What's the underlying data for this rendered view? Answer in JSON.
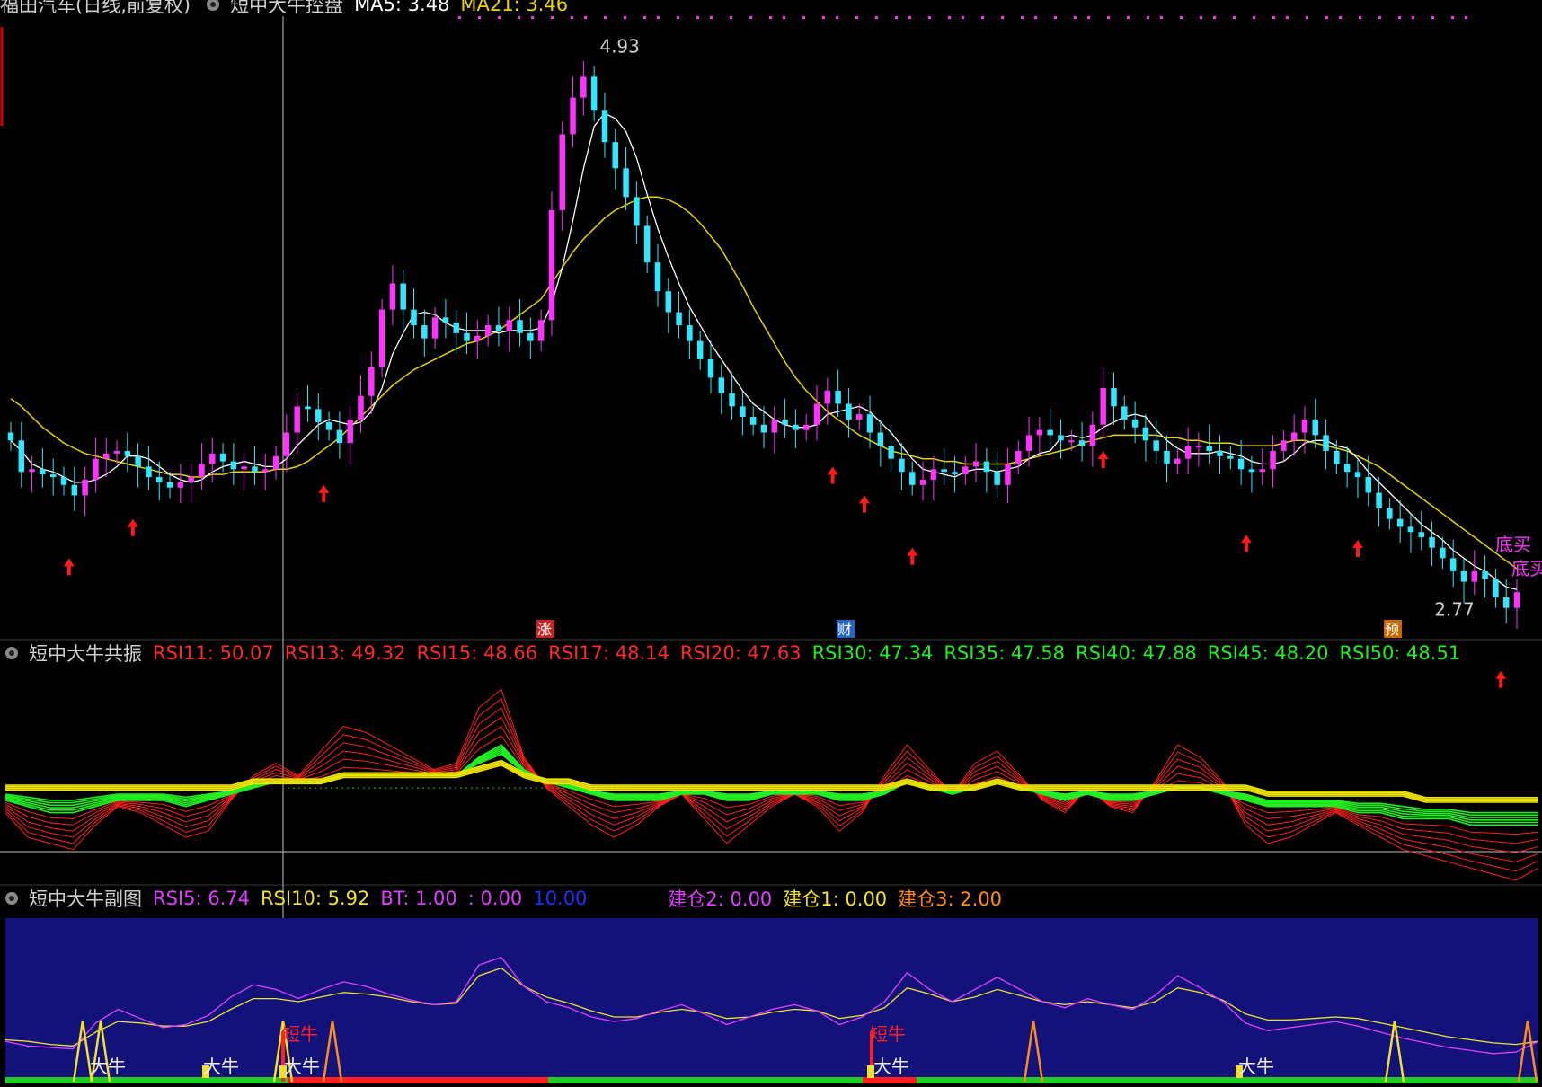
{
  "header_main": {
    "stock": "福田汽车(日线,前复权)",
    "indicator": "短中大牛控盘",
    "ma5": "MA5: 3.48",
    "ma21": "MA21: 3.46"
  },
  "colors": {
    "up": "#ff33ff",
    "down": "#33e6ff",
    "ma5": "#ffffff",
    "ma21": "#e5d400",
    "arrow": "#ff1a1a",
    "rsi_short": "#ff2020",
    "rsi_long": "#22ee22",
    "rsi_slow": "#f2e600",
    "sub_bg": "#12127a",
    "rsi5": "#e040ff",
    "rsi10": "#f0e030"
  },
  "chart_data": [
    {
      "type": "candlestick",
      "title": "福田汽车(日线,前复权)",
      "ylim": [
        2.7,
        5.0
      ],
      "high_label": "4.93",
      "low_label": "2.77",
      "close": [
        3.42,
        3.3,
        3.31,
        3.29,
        3.28,
        3.25,
        3.21,
        3.27,
        3.35,
        3.37,
        3.38,
        3.36,
        3.32,
        3.28,
        3.26,
        3.24,
        3.26,
        3.28,
        3.33,
        3.37,
        3.34,
        3.31,
        3.32,
        3.3,
        3.31,
        3.36,
        3.45,
        3.55,
        3.54,
        3.49,
        3.46,
        3.41,
        3.5,
        3.59,
        3.7,
        3.92,
        4.02,
        3.92,
        3.86,
        3.81,
        3.89,
        3.87,
        3.83,
        3.8,
        3.82,
        3.86,
        3.84,
        3.88,
        3.83,
        3.8,
        3.88,
        4.3,
        4.59,
        4.73,
        4.81,
        4.68,
        4.56,
        4.46,
        4.35,
        4.24,
        4.1,
        3.99,
        3.91,
        3.86,
        3.8,
        3.73,
        3.66,
        3.6,
        3.55,
        3.51,
        3.48,
        3.45,
        3.5,
        3.48,
        3.46,
        3.48,
        3.56,
        3.61,
        3.56,
        3.5,
        3.52,
        3.45,
        3.4,
        3.35,
        3.3,
        3.25,
        3.27,
        3.31,
        3.3,
        3.29,
        3.32,
        3.34,
        3.3,
        3.25,
        3.33,
        3.38,
        3.44,
        3.46,
        3.44,
        3.42,
        3.42,
        3.4,
        3.48,
        3.62,
        3.55,
        3.5,
        3.47,
        3.42,
        3.38,
        3.33,
        3.35,
        3.4,
        3.4,
        3.38,
        3.36,
        3.35,
        3.31,
        3.3,
        3.31,
        3.38,
        3.42,
        3.45,
        3.5,
        3.44,
        3.38,
        3.33,
        3.3,
        3.28,
        3.22,
        3.16,
        3.12,
        3.09,
        3.07,
        3.05,
        3.01,
        2.97,
        2.92,
        2.88,
        2.92,
        2.89,
        2.82,
        2.78,
        2.84
      ],
      "ma5": [
        3.42,
        3.38,
        3.33,
        3.31,
        3.3,
        3.28,
        3.26,
        3.26,
        3.27,
        3.29,
        3.32,
        3.36,
        3.36,
        3.35,
        3.32,
        3.29,
        3.27,
        3.26,
        3.27,
        3.3,
        3.32,
        3.33,
        3.34,
        3.33,
        3.32,
        3.32,
        3.35,
        3.4,
        3.44,
        3.48,
        3.5,
        3.49,
        3.48,
        3.49,
        3.53,
        3.62,
        3.75,
        3.83,
        3.9,
        3.91,
        3.9,
        3.87,
        3.85,
        3.84,
        3.84,
        3.84,
        3.83,
        3.84,
        3.84,
        3.84,
        3.85,
        3.94,
        4.08,
        4.26,
        4.46,
        4.62,
        4.67,
        4.65,
        4.6,
        4.5,
        4.36,
        4.23,
        4.12,
        4.02,
        3.93,
        3.86,
        3.79,
        3.73,
        3.67,
        3.61,
        3.56,
        3.53,
        3.5,
        3.48,
        3.47,
        3.47,
        3.48,
        3.52,
        3.53,
        3.54,
        3.55,
        3.53,
        3.49,
        3.45,
        3.4,
        3.35,
        3.31,
        3.3,
        3.29,
        3.28,
        3.3,
        3.31,
        3.31,
        3.3,
        3.31,
        3.32,
        3.35,
        3.37,
        3.38,
        3.43,
        3.44,
        3.43,
        3.44,
        3.47,
        3.49,
        3.51,
        3.52,
        3.51,
        3.46,
        3.42,
        3.39,
        3.37,
        3.37,
        3.37,
        3.38,
        3.37,
        3.36,
        3.34,
        3.33,
        3.33,
        3.34,
        3.37,
        3.41,
        3.42,
        3.42,
        3.4,
        3.39,
        3.35,
        3.3,
        3.26,
        3.22,
        3.18,
        3.14,
        3.1,
        3.07,
        3.04,
        3.0,
        2.97,
        2.94,
        2.92,
        2.89,
        2.86,
        2.85
      ],
      "ma21": [
        3.58,
        3.55,
        3.51,
        3.47,
        3.44,
        3.41,
        3.39,
        3.37,
        3.36,
        3.35,
        3.34,
        3.33,
        3.32,
        3.31,
        3.3,
        3.29,
        3.29,
        3.28,
        3.28,
        3.29,
        3.29,
        3.3,
        3.3,
        3.3,
        3.3,
        3.31,
        3.31,
        3.32,
        3.34,
        3.37,
        3.4,
        3.43,
        3.47,
        3.51,
        3.55,
        3.59,
        3.63,
        3.66,
        3.69,
        3.71,
        3.73,
        3.75,
        3.77,
        3.79,
        3.8,
        3.82,
        3.84,
        3.87,
        3.9,
        3.93,
        3.96,
        4.02,
        4.08,
        4.14,
        4.19,
        4.23,
        4.27,
        4.3,
        4.32,
        4.34,
        4.35,
        4.35,
        4.34,
        4.32,
        4.29,
        4.25,
        4.2,
        4.15,
        4.08,
        4.01,
        3.93,
        3.86,
        3.79,
        3.72,
        3.66,
        3.61,
        3.57,
        3.53,
        3.5,
        3.47,
        3.44,
        3.42,
        3.4,
        3.38,
        3.37,
        3.36,
        3.35,
        3.35,
        3.34,
        3.34,
        3.33,
        3.33,
        3.33,
        3.33,
        3.33,
        3.34,
        3.35,
        3.36,
        3.37,
        3.38,
        3.39,
        3.41,
        3.42,
        3.43,
        3.44,
        3.44,
        3.44,
        3.44,
        3.44,
        3.43,
        3.43,
        3.42,
        3.42,
        3.41,
        3.41,
        3.41,
        3.4,
        3.4,
        3.4,
        3.4,
        3.41,
        3.42,
        3.42,
        3.41,
        3.4,
        3.39,
        3.38,
        3.36,
        3.34,
        3.32,
        3.29,
        3.26,
        3.23,
        3.2,
        3.17,
        3.14,
        3.11,
        3.08,
        3.05,
        3.02,
        2.99,
        2.96,
        2.93
      ],
      "annotations": {
        "buy_text": [
          "底买",
          "底买"
        ],
        "markers": [
          "涨",
          "财",
          "预"
        ]
      }
    },
    {
      "type": "line",
      "title": "短中大牛共振",
      "legend": [
        "RSI11: 50.07",
        "RSI13: 49.32",
        "RSI15: 48.66",
        "RSI17: 48.14",
        "RSI20: 47.63",
        "RSI30: 47.34",
        "RSI35: 47.58",
        "RSI40: 47.88",
        "RSI45: 48.20",
        "RSI50: 48.51"
      ],
      "ylim": [
        35,
        70
      ],
      "series": [
        {
          "name": "RSI11",
          "values": [
            46,
            42,
            41,
            40,
            44,
            47,
            46,
            44,
            42,
            43,
            48,
            52,
            54,
            52,
            56,
            60,
            59,
            57,
            55,
            53,
            54,
            63,
            66,
            55,
            50,
            47,
            44,
            42,
            44,
            47,
            49,
            45,
            41,
            44,
            47,
            49,
            47,
            43,
            46,
            52,
            57,
            53,
            49,
            54,
            56,
            52,
            48,
            46,
            50,
            47,
            46,
            51,
            57,
            55,
            51,
            44,
            41,
            42,
            44,
            46,
            44,
            42,
            40,
            39,
            38,
            37,
            36,
            35,
            37
          ]
        },
        {
          "name": "RSI30",
          "values": [
            48,
            47,
            46,
            46,
            47,
            48,
            48,
            48,
            47,
            48,
            49,
            50,
            51,
            51,
            51,
            52,
            52,
            52,
            52,
            52,
            52,
            55,
            57,
            53,
            51,
            50,
            49,
            48,
            48,
            48,
            49,
            49,
            48,
            48,
            49,
            49,
            49,
            48,
            48,
            49,
            51,
            50,
            49,
            50,
            51,
            50,
            49,
            48,
            49,
            48,
            48,
            49,
            50,
            50,
            49,
            48,
            47,
            47,
            47,
            47,
            46,
            46,
            45,
            45,
            45,
            44,
            44,
            44,
            44
          ]
        },
        {
          "name": "RSI50",
          "values": [
            50,
            50,
            50,
            50,
            50,
            50,
            50,
            50,
            50,
            50,
            50,
            51,
            51,
            51,
            51,
            52,
            52,
            52,
            52,
            52,
            52,
            53,
            54,
            52,
            51,
            51,
            50,
            50,
            50,
            50,
            50,
            50,
            50,
            50,
            50,
            50,
            50,
            50,
            50,
            50,
            51,
            50,
            50,
            50,
            51,
            50,
            50,
            50,
            50,
            50,
            50,
            50,
            50,
            50,
            50,
            50,
            49,
            49,
            49,
            49,
            49,
            49,
            49,
            48,
            48,
            48,
            48,
            48,
            48
          ]
        }
      ]
    },
    {
      "type": "line",
      "title": "短中大牛副图",
      "legend": [
        "RSI5: 6.74",
        "RSI10: 5.92",
        "BT: 1.00",
        ": 0.00",
        "10.00",
        "建仓2: 0.00",
        "建仓1: 0.00",
        "建仓3: 2.00"
      ],
      "ylim": [
        0,
        10
      ],
      "series": [
        {
          "name": "RSI5",
          "values": [
            2.4,
            2.1,
            2.0,
            1.9,
            3.6,
            4.5,
            3.9,
            3.3,
            3.5,
            4.1,
            5.3,
            6.1,
            5.8,
            5.2,
            5.8,
            6.3,
            6.0,
            5.5,
            5.1,
            4.8,
            5.0,
            7.4,
            7.9,
            6.0,
            5.0,
            4.6,
            4.0,
            3.7,
            3.9,
            4.4,
            4.8,
            4.2,
            3.5,
            4.0,
            4.5,
            4.8,
            4.4,
            3.5,
            4.0,
            5.0,
            6.9,
            5.8,
            5.0,
            5.8,
            6.6,
            5.8,
            5.0,
            4.6,
            5.2,
            4.8,
            4.5,
            5.4,
            6.7,
            5.9,
            5.0,
            3.6,
            3.1,
            3.3,
            3.5,
            3.7,
            3.4,
            3.0,
            2.6,
            2.3,
            2.0,
            1.8,
            1.6,
            1.7,
            2.4
          ]
        },
        {
          "name": "RSI10",
          "values": [
            2.5,
            2.4,
            2.2,
            2.1,
            3.0,
            3.7,
            3.6,
            3.4,
            3.4,
            3.7,
            4.5,
            5.2,
            5.2,
            5.0,
            5.3,
            5.6,
            5.5,
            5.3,
            5.0,
            4.8,
            4.9,
            6.7,
            7.2,
            6.0,
            5.3,
            4.9,
            4.4,
            4.0,
            4.0,
            4.3,
            4.5,
            4.3,
            3.9,
            4.0,
            4.3,
            4.5,
            4.4,
            3.9,
            4.1,
            4.6,
            5.9,
            5.5,
            5.0,
            5.3,
            5.8,
            5.4,
            5.0,
            4.8,
            5.0,
            4.8,
            4.6,
            5.0,
            5.9,
            5.6,
            5.1,
            4.2,
            3.8,
            3.8,
            3.9,
            4.0,
            3.9,
            3.6,
            3.3,
            3.0,
            2.7,
            2.5,
            2.3,
            2.2,
            2.4
          ]
        }
      ],
      "signal_labels": [
        "短牛",
        "短牛",
        "大牛",
        "大牛",
        "大牛",
        "大牛",
        "大牛"
      ]
    }
  ]
}
